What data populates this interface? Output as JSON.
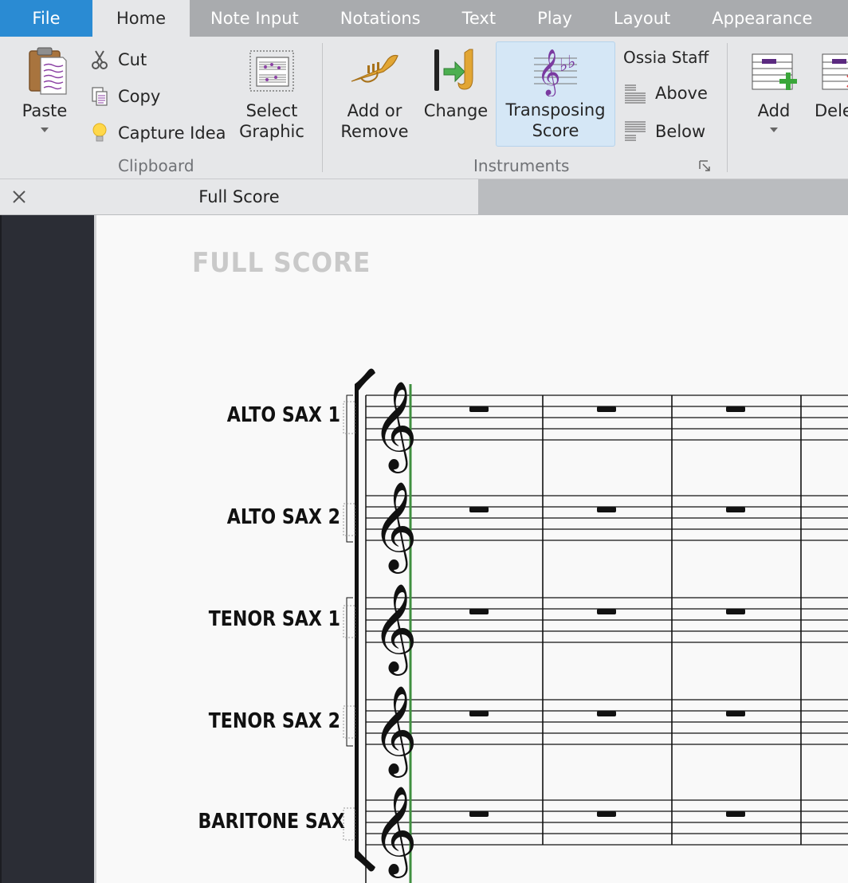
{
  "tabs": [
    {
      "label": "File"
    },
    {
      "label": "Home"
    },
    {
      "label": "Note Input"
    },
    {
      "label": "Notations"
    },
    {
      "label": "Text"
    },
    {
      "label": "Play"
    },
    {
      "label": "Layout"
    },
    {
      "label": "Appearance"
    }
  ],
  "ribbon": {
    "clipboard": {
      "paste_label": "Paste",
      "cut_label": "Cut",
      "copy_label": "Copy",
      "capture_idea_label": "Capture Idea",
      "select_graphic_label_1": "Select",
      "select_graphic_label_2": "Graphic",
      "group_label": "Clipboard"
    },
    "instruments": {
      "add_remove_label_1": "Add or",
      "add_remove_label_2": "Remove",
      "change_label": "Change",
      "transposing_label_1": "Transposing",
      "transposing_label_2": "Score",
      "ossia_staff_label": "Ossia Staff",
      "above_label": "Above",
      "below_label": "Below",
      "group_label": "Instruments"
    },
    "bars": {
      "add_label": "Add",
      "delete_label": "Dele"
    }
  },
  "document": {
    "tab_title": "Full Score"
  },
  "score": {
    "title": "FULL SCORE",
    "instruments": [
      {
        "name": "ALTO SAX 1"
      },
      {
        "name": "ALTO SAX 2"
      },
      {
        "name": "TENOR SAX 1"
      },
      {
        "name": "TENOR SAX 2"
      },
      {
        "name": "BARITONE SAX"
      }
    ]
  },
  "colors": {
    "file_tab": "#2a8bd3",
    "tab_bar": "#a9abae",
    "ribbon": "#e6e7e9",
    "selection_highlight": "#d5e7f6",
    "sidebar": "#2b2d35",
    "playback_line": "#3f8f3f"
  }
}
